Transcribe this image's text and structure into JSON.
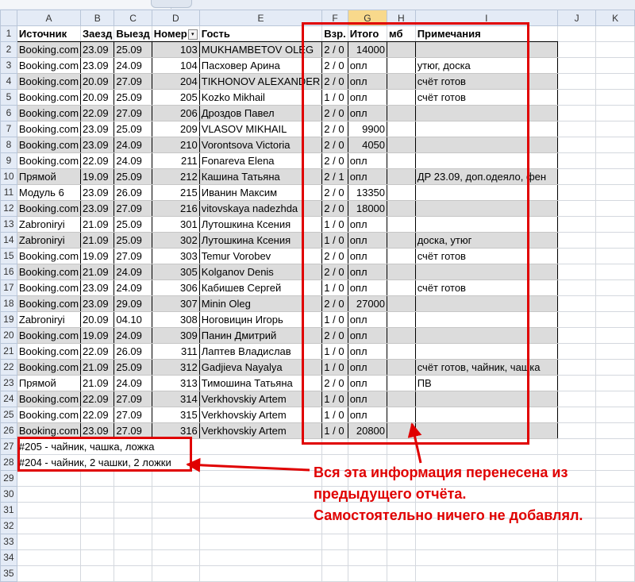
{
  "columns": [
    "A",
    "B",
    "C",
    "D",
    "E",
    "F",
    "G",
    "H",
    "I",
    "J",
    "K"
  ],
  "header": {
    "row": "1",
    "cells": [
      "Источник",
      "Заезд",
      "Выезд",
      "Номер",
      "Гость",
      "Взр.",
      "Итого",
      "мб",
      "Примечания"
    ]
  },
  "rows": [
    {
      "r": "2",
      "a": "Booking.com",
      "b": "23.09",
      "c": "25.09",
      "d": "103",
      "e": "MUKHAMBETOV OLEG",
      "f": "2 / 0",
      "g": "14000",
      "h": "",
      "i": ""
    },
    {
      "r": "3",
      "a": "Booking.com",
      "b": "23.09",
      "c": "24.09",
      "d": "104",
      "e": "Пасховер Арина",
      "f": "2 / 0",
      "g": "опл",
      "h": "",
      "i": "утюг, доска"
    },
    {
      "r": "4",
      "a": "Booking.com",
      "b": "20.09",
      "c": "27.09",
      "d": "204",
      "e": "TIKHONOV ALEXANDER",
      "f": "2 / 0",
      "g": "опл",
      "h": "",
      "i": "счёт готов"
    },
    {
      "r": "5",
      "a": "Booking.com",
      "b": "20.09",
      "c": "25.09",
      "d": "205",
      "e": "Kozko Mikhail",
      "f": "1 / 0",
      "g": "опл",
      "h": "",
      "i": "счёт готов"
    },
    {
      "r": "6",
      "a": "Booking.com",
      "b": "22.09",
      "c": "27.09",
      "d": "206",
      "e": "Дроздов Павел",
      "f": "2 / 0",
      "g": "опл",
      "h": "",
      "i": ""
    },
    {
      "r": "7",
      "a": "Booking.com",
      "b": "23.09",
      "c": "25.09",
      "d": "209",
      "e": "VLASOV MIKHAIL",
      "f": "2 / 0",
      "g": "9900",
      "h": "",
      "i": ""
    },
    {
      "r": "8",
      "a": "Booking.com",
      "b": "23.09",
      "c": "24.09",
      "d": "210",
      "e": "Vorontsova Victoria",
      "f": "2 / 0",
      "g": "4050",
      "h": "",
      "i": ""
    },
    {
      "r": "9",
      "a": "Booking.com",
      "b": "22.09",
      "c": "24.09",
      "d": "211",
      "e": "Fonareva Elena",
      "f": "2 / 0",
      "g": "опл",
      "h": "",
      "i": ""
    },
    {
      "r": "10",
      "a": "Прямой",
      "b": "19.09",
      "c": "25.09",
      "d": "212",
      "e": "Кашина Татьяна",
      "f": "2 / 1",
      "g": "опл",
      "h": "",
      "i": "ДР 23.09, доп.одеяло, фен"
    },
    {
      "r": "11",
      "a": "Модуль 6",
      "b": "23.09",
      "c": "26.09",
      "d": "215",
      "e": "Иванин Максим",
      "f": "2 / 0",
      "g": "13350",
      "h": "",
      "i": ""
    },
    {
      "r": "12",
      "a": "Booking.com",
      "b": "23.09",
      "c": "27.09",
      "d": "216",
      "e": "vitovskaya nadezhda",
      "f": "2 / 0",
      "g": "18000",
      "h": "",
      "i": ""
    },
    {
      "r": "13",
      "a": "Zabroniryi",
      "b": "21.09",
      "c": "25.09",
      "d": "301",
      "e": "Лутошкина Ксения",
      "f": "1 / 0",
      "g": "опл",
      "h": "",
      "i": ""
    },
    {
      "r": "14",
      "a": "Zabroniryi",
      "b": "21.09",
      "c": "25.09",
      "d": "302",
      "e": "Лутошкина Ксения",
      "f": "1 / 0",
      "g": "опл",
      "h": "",
      "i": "доска, утюг"
    },
    {
      "r": "15",
      "a": "Booking.com",
      "b": "19.09",
      "c": "27.09",
      "d": "303",
      "e": "Temur Vorobev",
      "f": "2 / 0",
      "g": "опл",
      "h": "",
      "i": "счёт готов"
    },
    {
      "r": "16",
      "a": "Booking.com",
      "b": "21.09",
      "c": "24.09",
      "d": "305",
      "e": "Kolganov Denis",
      "f": "2 / 0",
      "g": "опл",
      "h": "",
      "i": ""
    },
    {
      "r": "17",
      "a": "Booking.com",
      "b": "23.09",
      "c": "24.09",
      "d": "306",
      "e": "Кабишев Сергей",
      "f": "1 / 0",
      "g": "опл",
      "h": "",
      "i": "счёт готов"
    },
    {
      "r": "18",
      "a": "Booking.com",
      "b": "23.09",
      "c": "29.09",
      "d": "307",
      "e": "Minin Oleg",
      "f": "2 / 0",
      "g": "27000",
      "h": "",
      "i": ""
    },
    {
      "r": "19",
      "a": "Zabroniryi",
      "b": "20.09",
      "c": "04.10",
      "d": "308",
      "e": "Ноговицин Игорь",
      "f": "1 / 0",
      "g": "опл",
      "h": "",
      "i": ""
    },
    {
      "r": "20",
      "a": "Booking.com",
      "b": "19.09",
      "c": "24.09",
      "d": "309",
      "e": "Панин Дмитрий",
      "f": "2 / 0",
      "g": "опл",
      "h": "",
      "i": ""
    },
    {
      "r": "21",
      "a": "Booking.com",
      "b": "22.09",
      "c": "26.09",
      "d": "311",
      "e": "Лаптев Владислав",
      "f": "1 / 0",
      "g": "опл",
      "h": "",
      "i": ""
    },
    {
      "r": "22",
      "a": "Booking.com",
      "b": "21.09",
      "c": "25.09",
      "d": "312",
      "e": "Gadjieva Nayalya",
      "f": "1 / 0",
      "g": "опл",
      "h": "",
      "i": "счёт готов, чайник, чашка"
    },
    {
      "r": "23",
      "a": "Прямой",
      "b": "21.09",
      "c": "24.09",
      "d": "313",
      "e": "Тимошина Татьяна",
      "f": "2 / 0",
      "g": "опл",
      "h": "",
      "i": "ПВ"
    },
    {
      "r": "24",
      "a": "Booking.com",
      "b": "22.09",
      "c": "27.09",
      "d": "314",
      "e": "Verkhovskiy Artem",
      "f": "1 / 0",
      "g": "опл",
      "h": "",
      "i": ""
    },
    {
      "r": "25",
      "a": "Booking.com",
      "b": "22.09",
      "c": "27.09",
      "d": "315",
      "e": "Verkhovskiy Artem",
      "f": "1 / 0",
      "g": "опл",
      "h": "",
      "i": ""
    },
    {
      "r": "26",
      "a": "Booking.com",
      "b": "23.09",
      "c": "27.09",
      "d": "316",
      "e": "Verkhovskiy Artem",
      "f": "1 / 0",
      "g": "20800",
      "h": "",
      "i": ""
    }
  ],
  "notes": [
    {
      "r": "27",
      "text": "#205 - чайник, чашка, ложка"
    },
    {
      "r": "28",
      "text": "#204 - чайник, 2 чашки, 2 ложки"
    }
  ],
  "empty_rows": [
    "29",
    "30",
    "31",
    "32",
    "33",
    "34",
    "35"
  ],
  "annotation": {
    "line1": "Вся эта информация перенесена из",
    "line2": "предыдущего отчёта.",
    "line3": "Самостоятельно ничего не добавлял."
  },
  "colors": {
    "annotation": "#e00000",
    "shade": "#dcdcdc",
    "header_sel": "#f8d98c"
  }
}
